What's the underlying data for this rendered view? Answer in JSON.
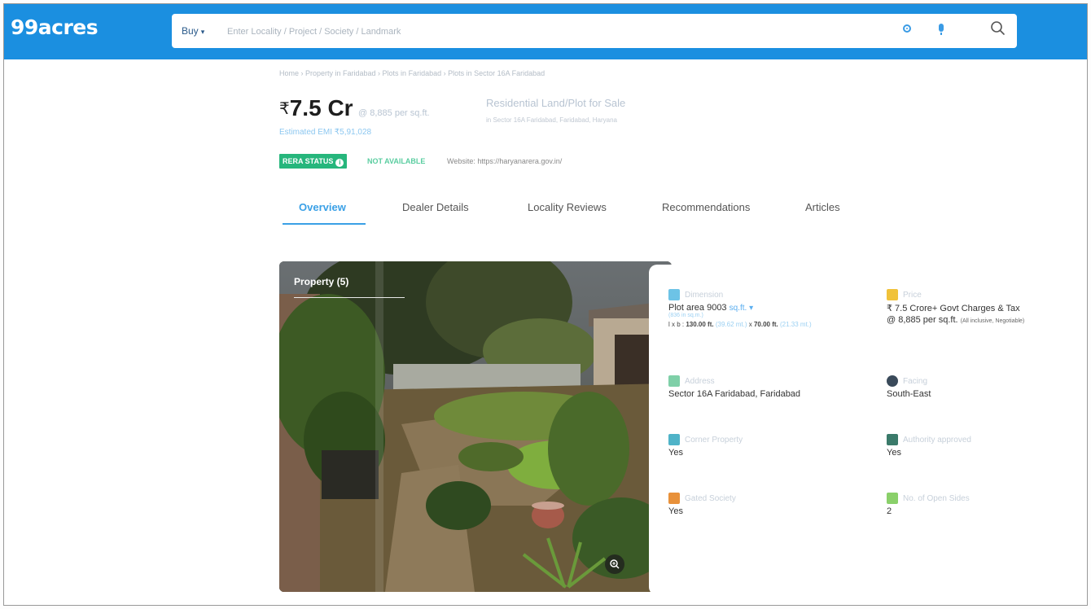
{
  "header": {
    "logo": "99acres",
    "buy_label": "Buy",
    "search_placeholder": "Enter Locality / Project / Society / Landmark"
  },
  "breadcrumb": "Home › Property in Faridabad › Plots in Faridabad › Plots in Sector 16A Faridabad",
  "price": {
    "rupee": "₹",
    "amount": "7.5 Cr",
    "per_sqft": "@ 8,885 per sq.ft.",
    "emi": "Estimated EMI ₹5,91,028"
  },
  "property": {
    "type": "Residential Land/Plot for Sale",
    "location": "in Sector 16A Faridabad, Faridabad, Haryana"
  },
  "rera": {
    "badge": "RERA STATUS",
    "badge_icon": "i",
    "status": "NOT AVAILABLE",
    "website": "Website: https://haryanarera.gov.in/"
  },
  "tabs": [
    "Overview",
    "Dealer Details",
    "Locality Reviews",
    "Recommendations",
    "Articles"
  ],
  "photo": {
    "label": "Property (5)"
  },
  "details": {
    "dimension": {
      "label": "Dimension",
      "value": "Plot area 9003",
      "unit": "sq.ft.",
      "sub": "(836 in sq.m.)",
      "dims_prefix": "l x b : ",
      "length": "130.00 ft.",
      "length_m": "(39.62 mt.)",
      "times": " x ",
      "breadth": "70.00 ft.",
      "breadth_m": "(21.33 mt.)"
    },
    "price": {
      "label": "Price",
      "value": "₹ 7.5 Crore",
      "extra": "+ Govt Charges & Tax",
      "per": "@ 8,885 per sq.ft.",
      "note": "(All inclusive, Negotiable)"
    },
    "address": {
      "label": "Address",
      "value": "Sector 16A Faridabad, Faridabad"
    },
    "facing": {
      "label": "Facing",
      "value": "South-East"
    },
    "corner": {
      "label": "Corner Property",
      "value": "Yes"
    },
    "authority": {
      "label": "Authority approved",
      "value": "Yes"
    },
    "gated": {
      "label": "Gated Society",
      "value": "Yes"
    },
    "open_sides": {
      "label": "No. of Open Sides",
      "value": "2"
    }
  },
  "colors": {
    "brand": "#1b8fe0",
    "accent": "#3aa0e6",
    "rera_green": "#26b67c"
  }
}
